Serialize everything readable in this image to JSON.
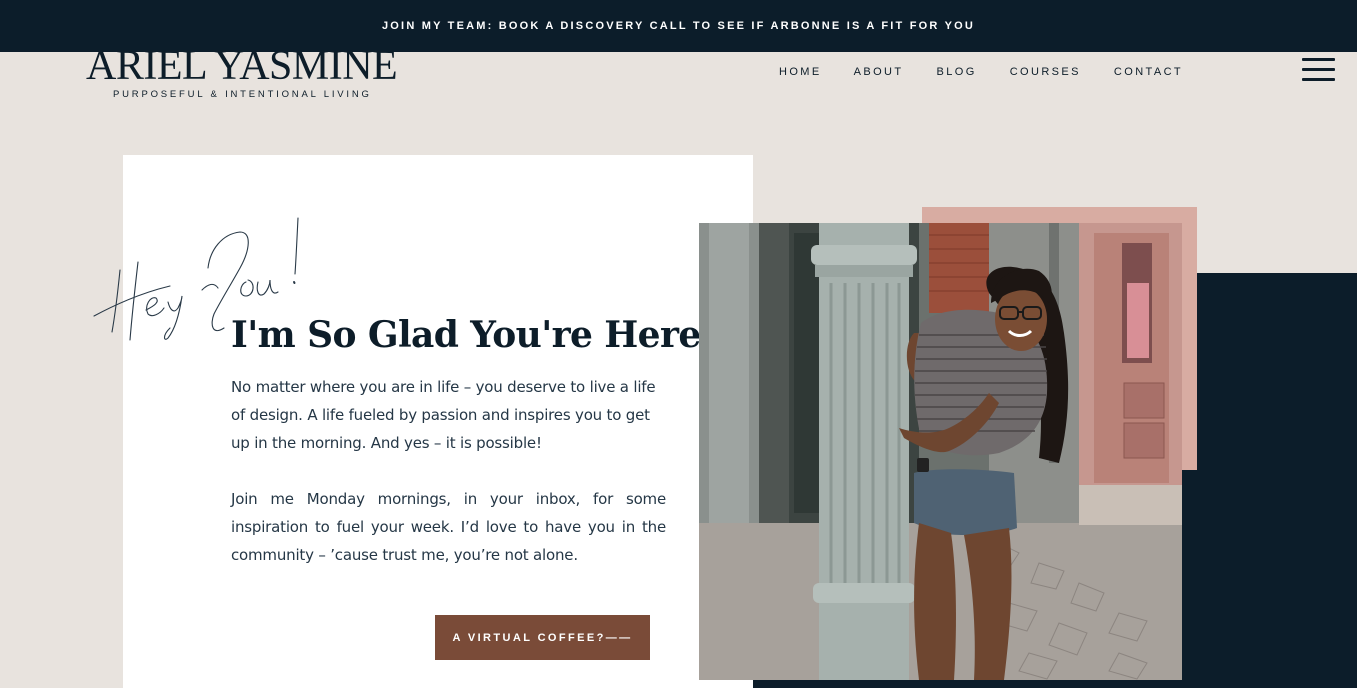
{
  "announcement": {
    "text": "JOIN MY TEAM: BOOK A DISCOVERY CALL TO SEE IF ARBONNE IS A FIT FOR YOU"
  },
  "logo": {
    "name": "ARIEL YASMINE",
    "tagline": "PURPOSEFUL & INTENTIONAL LIVING"
  },
  "nav": {
    "items": [
      {
        "label": "HOME"
      },
      {
        "label": "ABOUT"
      },
      {
        "label": "BLOG"
      },
      {
        "label": "COURSES"
      },
      {
        "label": "CONTACT"
      }
    ],
    "menu_icon": "hamburger-icon"
  },
  "hero": {
    "script_text": "Hey You!",
    "headline": "I'm So Glad You're Here.",
    "paragraph1": "No matter where you are in life – you deserve to live a life of design. A life fueled by passion and inspires you to get up in the morning.  And yes – it is possible!",
    "paragraph2": "Join me Monday mornings, in your inbox, for some inspiration to fuel your week. I’d love to have you in the community – ’cause trust me, you’re not alone.",
    "cta_label": "A VIRTUAL COFFEE?——"
  },
  "colors": {
    "navy": "#0c1d2a",
    "beige": "#e8e3de",
    "pink": "#d8aca2",
    "brown": "#7a4b38"
  }
}
